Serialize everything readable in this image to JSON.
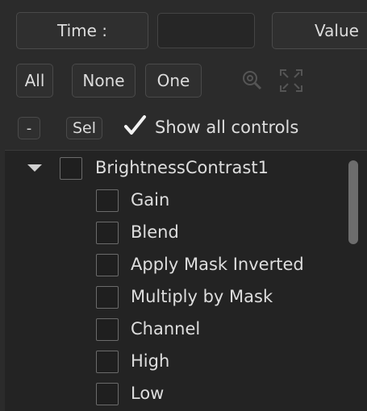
{
  "toolbar": {
    "time_label": "Time :",
    "time_value": "",
    "value_label": "Value"
  },
  "filters": {
    "all_label": "All",
    "none_label": "None",
    "one_label": "One"
  },
  "selection": {
    "minus_label": "-",
    "sel_label": "Sel",
    "show_all_label": "Show all controls",
    "show_all_checked": true
  },
  "tree": {
    "root": {
      "label": "BrightnessContrast1",
      "expanded": true,
      "checked": false
    },
    "children": [
      {
        "label": "Gain",
        "checked": false
      },
      {
        "label": "Blend",
        "checked": false
      },
      {
        "label": "Apply Mask Inverted",
        "checked": false
      },
      {
        "label": "Multiply by Mask",
        "checked": false
      },
      {
        "label": "Channel",
        "checked": false
      },
      {
        "label": "High",
        "checked": false
      },
      {
        "label": "Low",
        "checked": false
      }
    ]
  },
  "icons": {
    "zoom": "zoom-icon",
    "fit": "fit-icon"
  }
}
